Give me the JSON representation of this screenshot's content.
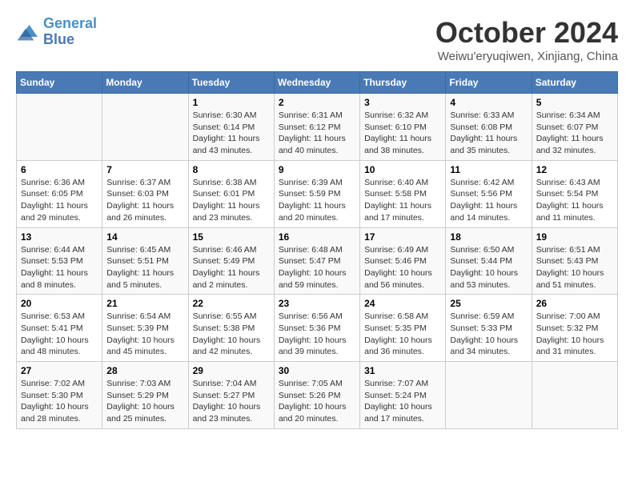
{
  "logo": {
    "line1": "General",
    "line2": "Blue"
  },
  "title": "October 2024",
  "location": "Weiwu'eryuqiwen, Xinjiang, China",
  "days_of_week": [
    "Sunday",
    "Monday",
    "Tuesday",
    "Wednesday",
    "Thursday",
    "Friday",
    "Saturday"
  ],
  "weeks": [
    [
      {
        "day": "",
        "sunrise": "",
        "sunset": "",
        "daylight": ""
      },
      {
        "day": "",
        "sunrise": "",
        "sunset": "",
        "daylight": ""
      },
      {
        "day": "1",
        "sunrise": "Sunrise: 6:30 AM",
        "sunset": "Sunset: 6:14 PM",
        "daylight": "Daylight: 11 hours and 43 minutes."
      },
      {
        "day": "2",
        "sunrise": "Sunrise: 6:31 AM",
        "sunset": "Sunset: 6:12 PM",
        "daylight": "Daylight: 11 hours and 40 minutes."
      },
      {
        "day": "3",
        "sunrise": "Sunrise: 6:32 AM",
        "sunset": "Sunset: 6:10 PM",
        "daylight": "Daylight: 11 hours and 38 minutes."
      },
      {
        "day": "4",
        "sunrise": "Sunrise: 6:33 AM",
        "sunset": "Sunset: 6:08 PM",
        "daylight": "Daylight: 11 hours and 35 minutes."
      },
      {
        "day": "5",
        "sunrise": "Sunrise: 6:34 AM",
        "sunset": "Sunset: 6:07 PM",
        "daylight": "Daylight: 11 hours and 32 minutes."
      }
    ],
    [
      {
        "day": "6",
        "sunrise": "Sunrise: 6:36 AM",
        "sunset": "Sunset: 6:05 PM",
        "daylight": "Daylight: 11 hours and 29 minutes."
      },
      {
        "day": "7",
        "sunrise": "Sunrise: 6:37 AM",
        "sunset": "Sunset: 6:03 PM",
        "daylight": "Daylight: 11 hours and 26 minutes."
      },
      {
        "day": "8",
        "sunrise": "Sunrise: 6:38 AM",
        "sunset": "Sunset: 6:01 PM",
        "daylight": "Daylight: 11 hours and 23 minutes."
      },
      {
        "day": "9",
        "sunrise": "Sunrise: 6:39 AM",
        "sunset": "Sunset: 5:59 PM",
        "daylight": "Daylight: 11 hours and 20 minutes."
      },
      {
        "day": "10",
        "sunrise": "Sunrise: 6:40 AM",
        "sunset": "Sunset: 5:58 PM",
        "daylight": "Daylight: 11 hours and 17 minutes."
      },
      {
        "day": "11",
        "sunrise": "Sunrise: 6:42 AM",
        "sunset": "Sunset: 5:56 PM",
        "daylight": "Daylight: 11 hours and 14 minutes."
      },
      {
        "day": "12",
        "sunrise": "Sunrise: 6:43 AM",
        "sunset": "Sunset: 5:54 PM",
        "daylight": "Daylight: 11 hours and 11 minutes."
      }
    ],
    [
      {
        "day": "13",
        "sunrise": "Sunrise: 6:44 AM",
        "sunset": "Sunset: 5:53 PM",
        "daylight": "Daylight: 11 hours and 8 minutes."
      },
      {
        "day": "14",
        "sunrise": "Sunrise: 6:45 AM",
        "sunset": "Sunset: 5:51 PM",
        "daylight": "Daylight: 11 hours and 5 minutes."
      },
      {
        "day": "15",
        "sunrise": "Sunrise: 6:46 AM",
        "sunset": "Sunset: 5:49 PM",
        "daylight": "Daylight: 11 hours and 2 minutes."
      },
      {
        "day": "16",
        "sunrise": "Sunrise: 6:48 AM",
        "sunset": "Sunset: 5:47 PM",
        "daylight": "Daylight: 10 hours and 59 minutes."
      },
      {
        "day": "17",
        "sunrise": "Sunrise: 6:49 AM",
        "sunset": "Sunset: 5:46 PM",
        "daylight": "Daylight: 10 hours and 56 minutes."
      },
      {
        "day": "18",
        "sunrise": "Sunrise: 6:50 AM",
        "sunset": "Sunset: 5:44 PM",
        "daylight": "Daylight: 10 hours and 53 minutes."
      },
      {
        "day": "19",
        "sunrise": "Sunrise: 6:51 AM",
        "sunset": "Sunset: 5:43 PM",
        "daylight": "Daylight: 10 hours and 51 minutes."
      }
    ],
    [
      {
        "day": "20",
        "sunrise": "Sunrise: 6:53 AM",
        "sunset": "Sunset: 5:41 PM",
        "daylight": "Daylight: 10 hours and 48 minutes."
      },
      {
        "day": "21",
        "sunrise": "Sunrise: 6:54 AM",
        "sunset": "Sunset: 5:39 PM",
        "daylight": "Daylight: 10 hours and 45 minutes."
      },
      {
        "day": "22",
        "sunrise": "Sunrise: 6:55 AM",
        "sunset": "Sunset: 5:38 PM",
        "daylight": "Daylight: 10 hours and 42 minutes."
      },
      {
        "day": "23",
        "sunrise": "Sunrise: 6:56 AM",
        "sunset": "Sunset: 5:36 PM",
        "daylight": "Daylight: 10 hours and 39 minutes."
      },
      {
        "day": "24",
        "sunrise": "Sunrise: 6:58 AM",
        "sunset": "Sunset: 5:35 PM",
        "daylight": "Daylight: 10 hours and 36 minutes."
      },
      {
        "day": "25",
        "sunrise": "Sunrise: 6:59 AM",
        "sunset": "Sunset: 5:33 PM",
        "daylight": "Daylight: 10 hours and 34 minutes."
      },
      {
        "day": "26",
        "sunrise": "Sunrise: 7:00 AM",
        "sunset": "Sunset: 5:32 PM",
        "daylight": "Daylight: 10 hours and 31 minutes."
      }
    ],
    [
      {
        "day": "27",
        "sunrise": "Sunrise: 7:02 AM",
        "sunset": "Sunset: 5:30 PM",
        "daylight": "Daylight: 10 hours and 28 minutes."
      },
      {
        "day": "28",
        "sunrise": "Sunrise: 7:03 AM",
        "sunset": "Sunset: 5:29 PM",
        "daylight": "Daylight: 10 hours and 25 minutes."
      },
      {
        "day": "29",
        "sunrise": "Sunrise: 7:04 AM",
        "sunset": "Sunset: 5:27 PM",
        "daylight": "Daylight: 10 hours and 23 minutes."
      },
      {
        "day": "30",
        "sunrise": "Sunrise: 7:05 AM",
        "sunset": "Sunset: 5:26 PM",
        "daylight": "Daylight: 10 hours and 20 minutes."
      },
      {
        "day": "31",
        "sunrise": "Sunrise: 7:07 AM",
        "sunset": "Sunset: 5:24 PM",
        "daylight": "Daylight: 10 hours and 17 minutes."
      },
      {
        "day": "",
        "sunrise": "",
        "sunset": "",
        "daylight": ""
      },
      {
        "day": "",
        "sunrise": "",
        "sunset": "",
        "daylight": ""
      }
    ]
  ]
}
